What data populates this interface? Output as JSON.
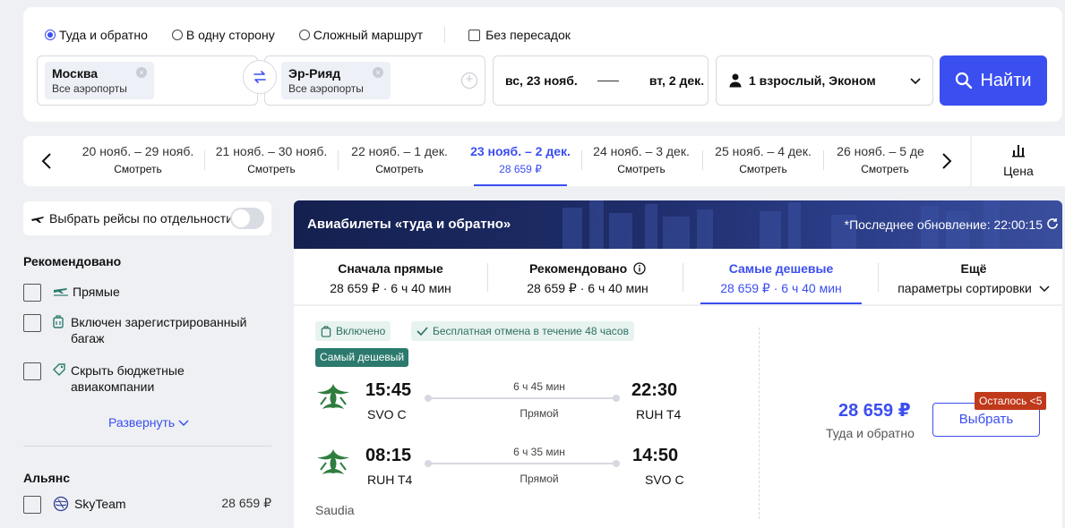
{
  "search": {
    "trip_types": [
      "Туда и обратно",
      "В одну сторону",
      "Сложный маршрут"
    ],
    "selected_trip_type": "Туда и обратно",
    "no_transfers_label": "Без пересадок",
    "from": {
      "city": "Москва",
      "airports": "Все аэропорты"
    },
    "to": {
      "city": "Эр-Рияд",
      "airports": "Все аэропорты"
    },
    "date_from": "вс, 23 нояб.",
    "date_to": "вт, 2 дек.",
    "passengers": "1 взрослый, Эконом",
    "find_label": "Найти"
  },
  "date_strip": {
    "items": [
      {
        "range": "20 нояб. – 29 нояб.",
        "sub": "Смотреть"
      },
      {
        "range": "21 нояб. – 30 нояб.",
        "sub": "Смотреть"
      },
      {
        "range": "22 нояб. – 1 дек.",
        "sub": "Смотреть"
      },
      {
        "range": "23 нояб. – 2 дек.",
        "sub": "28 659 ₽"
      },
      {
        "range": "24 нояб. – 3 дек.",
        "sub": "Смотреть"
      },
      {
        "range": "25 нояб. – 4 дек.",
        "sub": "Смотреть"
      },
      {
        "range": "26 нояб. – 5 дек.",
        "sub": "Смотреть"
      }
    ],
    "active_index": 3,
    "price_toggle_label": "Цена"
  },
  "filters": {
    "separate_flights_label": "Выбрать рейсы по отдельности",
    "recommended_title": "Рекомендовано",
    "recommended_items": [
      {
        "label": "Прямые",
        "icon": "direct-flight-icon"
      },
      {
        "label": "Включен зарегистрированный багаж",
        "icon": "luggage-icon"
      },
      {
        "label": "Скрыть бюджетные авиакомпании",
        "icon": "tag-icon"
      }
    ],
    "expand_label": "Развернуть",
    "alliance_title": "Альянс",
    "alliance_items": [
      {
        "label": "SkyTeam",
        "price": "28 659 ₽"
      }
    ]
  },
  "results": {
    "title": "Авиабилеты «туда и обратно»",
    "last_update": "*Последнее обновление: 22:00:15",
    "sort_tabs": [
      {
        "title": "Сначала прямые",
        "sub": "28 659 ₽ · 6 ч 40 мин"
      },
      {
        "title": "Рекомендовано",
        "sub": "28 659 ₽ · 6 ч 40 мин"
      },
      {
        "title": "Самые дешевые",
        "sub": "28 659 ₽ · 6 ч 40 мин"
      },
      {
        "title": "Ещё",
        "sub": "параметры сортировки"
      }
    ],
    "active_sort_index": 2,
    "card": {
      "badge_included": "Включено",
      "badge_cancel": "Бесплатная отмена в течение 48 часов",
      "badge_cheapest": "Самый дешевый",
      "legs": [
        {
          "dep_time": "15:45",
          "dep_airport": "SVO C",
          "duration": "6 ч 45 мин",
          "stops": "Прямой",
          "arr_time": "22:30",
          "arr_airport": "RUH T4"
        },
        {
          "dep_time": "08:15",
          "dep_airport": "RUH T4",
          "duration": "6 ч 35 мин",
          "stops": "Прямой",
          "arr_time": "14:50",
          "arr_airport": "SVO C"
        }
      ],
      "airline": "Saudia",
      "price": "28 659 ₽",
      "price_sub": "Туда и обратно",
      "seats_left": "Осталось <5",
      "select_label": "Выбрать"
    }
  },
  "colors": {
    "accent": "#3b4ef0",
    "green": "#2b7a6d",
    "warning": "#c0391b",
    "banner": "#1f2d6a"
  }
}
